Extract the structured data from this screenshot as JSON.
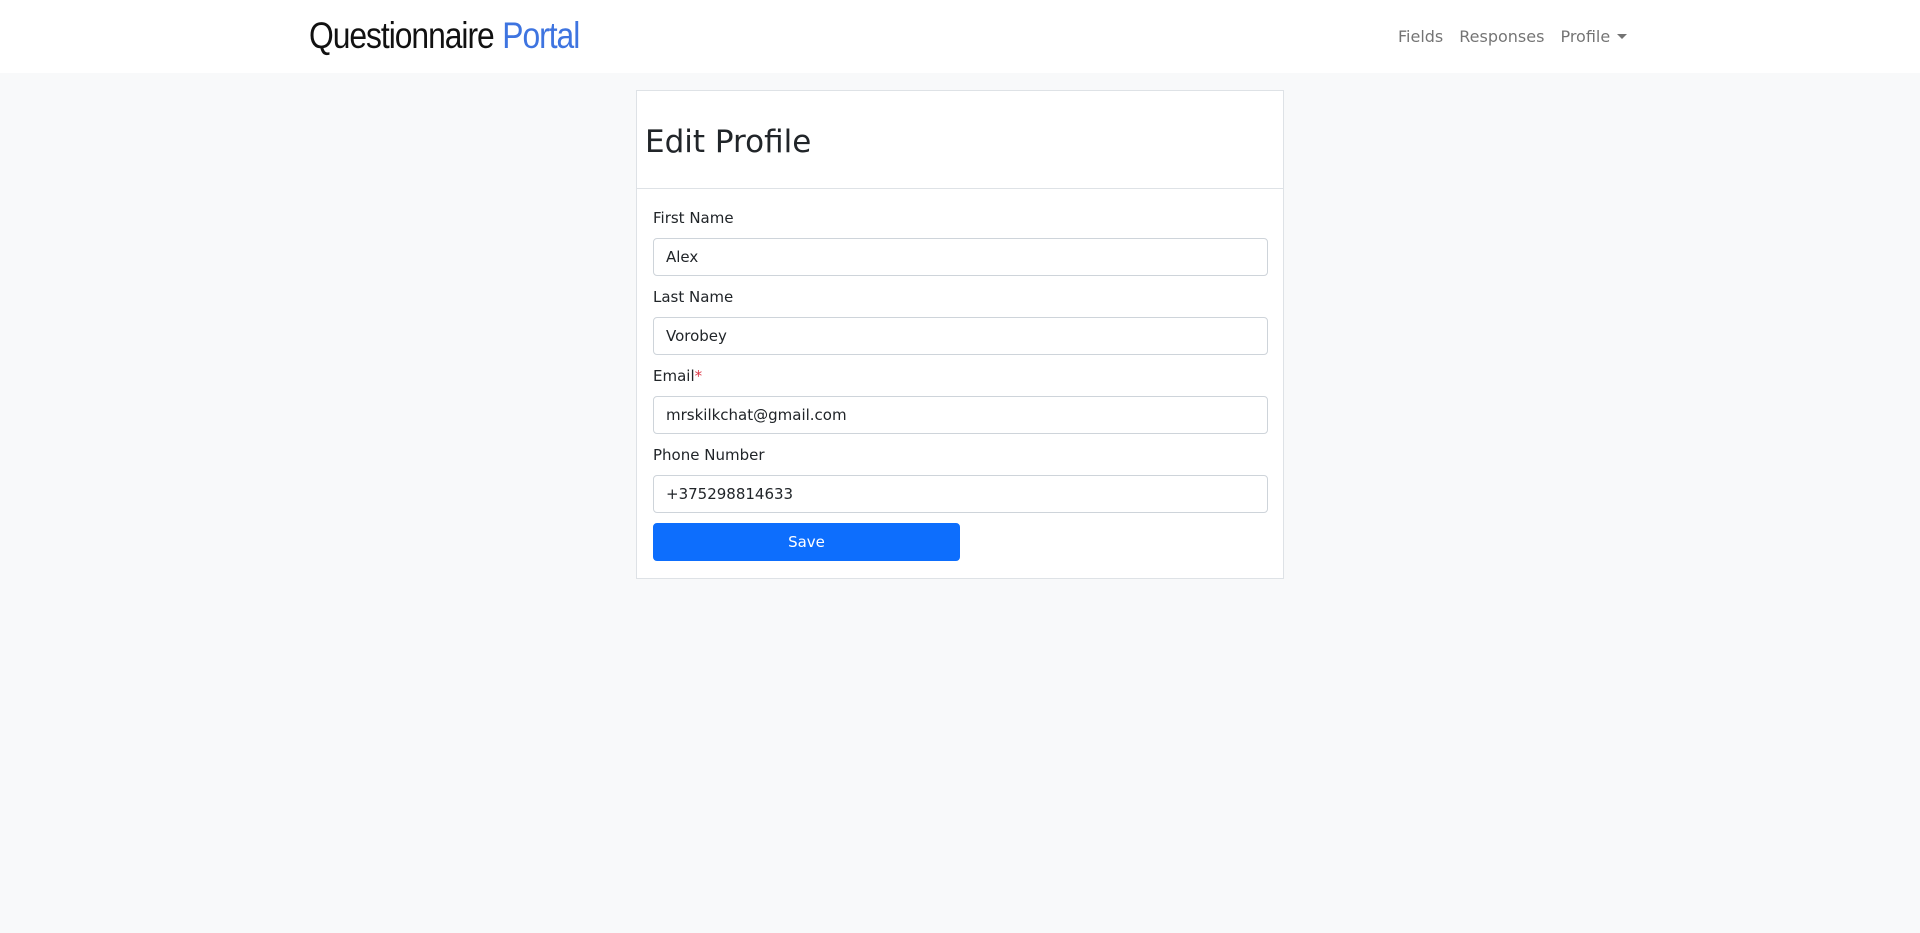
{
  "navbar": {
    "brand_part1": "Questionnaire",
    "brand_part2": "Portal",
    "links": {
      "fields": "Fields",
      "responses": "Responses",
      "profile": "Profile"
    }
  },
  "card": {
    "title": "Edit Profile",
    "fields": {
      "first_name": {
        "label": "First Name",
        "value": "Alex"
      },
      "last_name": {
        "label": "Last Name",
        "value": "Vorobey"
      },
      "email": {
        "label": "Email",
        "required_mark": "*",
        "value": "mrskilkchat@gmail.com"
      },
      "phone": {
        "label": "Phone Number",
        "value": "+375298814633"
      }
    },
    "save_label": "Save"
  },
  "colors": {
    "brand_accent": "#3e74e0",
    "primary_button": "#0d6efd",
    "required": "#dc3545",
    "page_background": "#f8f9fa"
  },
  "icons": {
    "profile_dropdown": "caret-down-icon"
  }
}
